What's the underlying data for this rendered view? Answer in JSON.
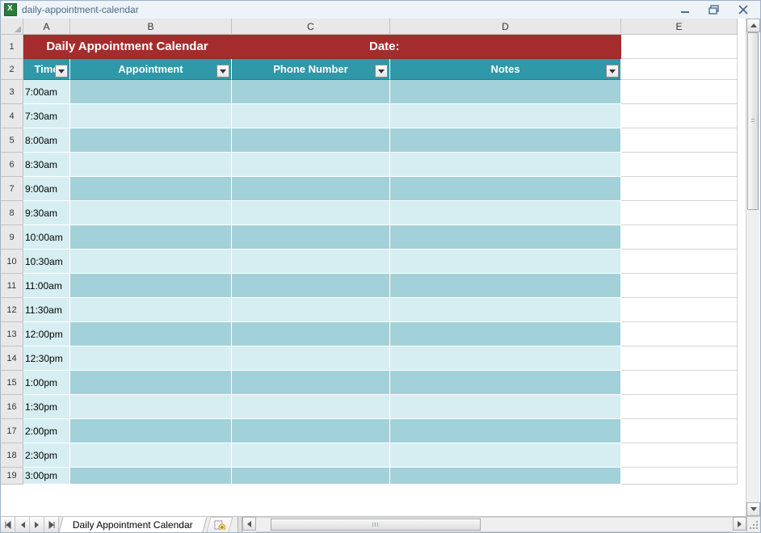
{
  "window": {
    "title": "daily-appointment-calendar"
  },
  "columns": [
    "A",
    "B",
    "C",
    "D",
    "E"
  ],
  "title_row": {
    "left": "Daily Appointment Calendar",
    "right": "Date:"
  },
  "header_row": {
    "time": "Time",
    "appointment": "Appointment",
    "phone": "Phone Number",
    "notes": "Notes"
  },
  "rows": [
    {
      "num": 3,
      "time": "7:00am"
    },
    {
      "num": 4,
      "time": "7:30am"
    },
    {
      "num": 5,
      "time": "8:00am"
    },
    {
      "num": 6,
      "time": "8:30am"
    },
    {
      "num": 7,
      "time": "9:00am"
    },
    {
      "num": 8,
      "time": "9:30am"
    },
    {
      "num": 9,
      "time": "10:00am"
    },
    {
      "num": 10,
      "time": "10:30am"
    },
    {
      "num": 11,
      "time": "11:00am"
    },
    {
      "num": 12,
      "time": "11:30am"
    },
    {
      "num": 13,
      "time": "12:00pm"
    },
    {
      "num": 14,
      "time": "12:30pm"
    },
    {
      "num": 15,
      "time": "1:00pm"
    },
    {
      "num": 16,
      "time": "1:30pm"
    },
    {
      "num": 17,
      "time": "2:00pm"
    },
    {
      "num": 18,
      "time": "2:30pm"
    },
    {
      "num": 19,
      "time": "3:00pm"
    }
  ],
  "row_heights": {
    "r1": 30,
    "r2": 26,
    "data": 30,
    "last": 21
  },
  "sheet_tab": "Daily Appointment Calendar"
}
